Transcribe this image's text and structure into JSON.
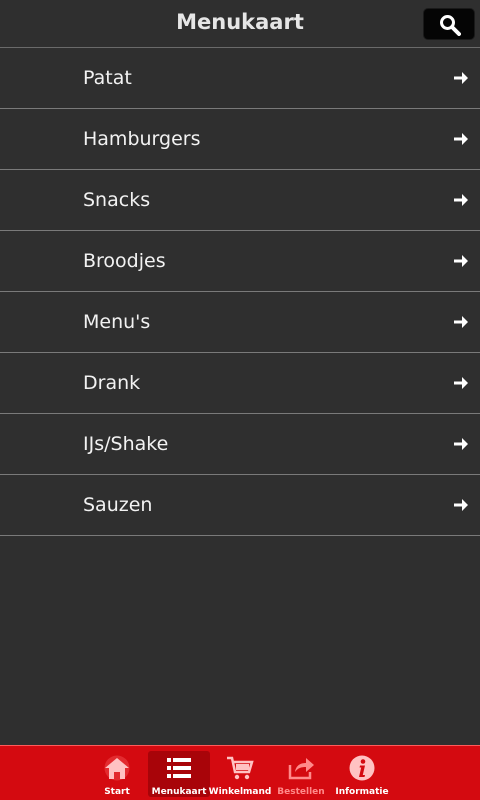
{
  "header": {
    "title": "Menukaart",
    "search_icon": "search-icon"
  },
  "menu": {
    "items": [
      {
        "label": "Patat",
        "icon": "arrow-right-icon"
      },
      {
        "label": "Hamburgers",
        "icon": "arrow-right-icon"
      },
      {
        "label": "Snacks",
        "icon": "arrow-right-icon"
      },
      {
        "label": "Broodjes",
        "icon": "arrow-right-icon"
      },
      {
        "label": "Menu's",
        "icon": "arrow-right-icon"
      },
      {
        "label": "Drank",
        "icon": "arrow-right-icon"
      },
      {
        "label": "IJs/Shake",
        "icon": "arrow-right-icon"
      },
      {
        "label": "Sauzen",
        "icon": "arrow-right-icon"
      }
    ]
  },
  "tabbar": {
    "tabs": [
      {
        "label": "Start",
        "icon": "home-icon",
        "active": false
      },
      {
        "label": "Menukaart",
        "icon": "list-icon",
        "active": true
      },
      {
        "label": "Winkelmand",
        "icon": "cart-icon",
        "active": false
      },
      {
        "label": "Bestellen",
        "icon": "share-icon",
        "active": false,
        "disabled": true
      },
      {
        "label": "Informatie",
        "icon": "info-icon",
        "active": false
      }
    ]
  },
  "colors": {
    "background": "#2f2f2f",
    "tabbar": "#d40a10",
    "tab_active": "#a80409",
    "text": "#ffffff"
  }
}
